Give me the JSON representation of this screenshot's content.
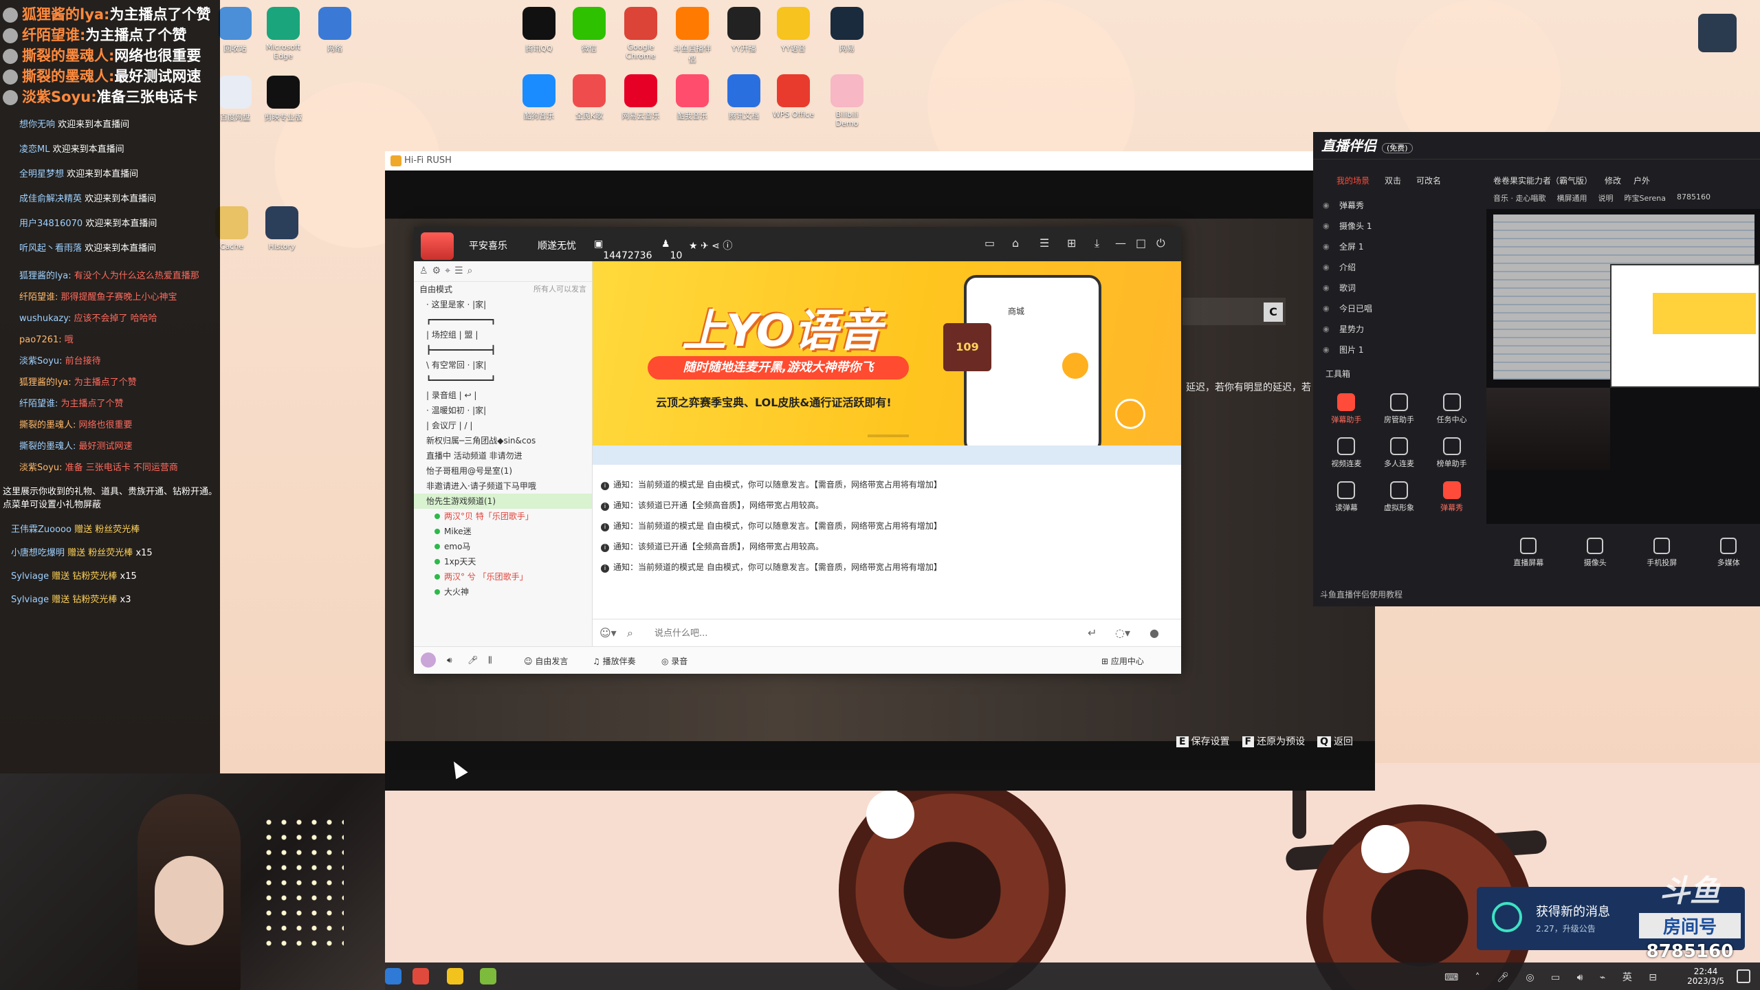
{
  "chat": {
    "big_lines": [
      {
        "user": "狐狸酱的lya:",
        "text": "为主播点了个赞"
      },
      {
        "user": "纤陌望谁:",
        "text": "为主播点了个赞"
      },
      {
        "user": "撕裂的墨魂人:",
        "text": "网络也很重要"
      },
      {
        "user": "撕裂的墨魂人:",
        "text": "最好测试网速"
      },
      {
        "user": "淡紫Soyu:",
        "text": "准备三张电话卡"
      }
    ],
    "welcomes": [
      {
        "user": "想你无响",
        "text": "欢迎来到本直播间"
      },
      {
        "user": "凌恋ML",
        "text": "欢迎来到本直播间"
      },
      {
        "user": "全明星梦想",
        "text": "欢迎来到本直播间"
      },
      {
        "user": "成佳俞解决精英",
        "text": "欢迎来到本直播间"
      },
      {
        "user": "用户34816070",
        "text": "欢迎来到本直播间"
      },
      {
        "user": "听风起丶看雨落",
        "text": "欢迎来到本直播间"
      }
    ],
    "messages": [
      {
        "user": "狐狸酱的lya:",
        "text": "有没个人为什么这么热爱直播那"
      },
      {
        "user": "纤陌望谁:",
        "text": "那得提醒鱼子赛晚上小心神宝"
      },
      {
        "user": "wushukazy:",
        "text": "应该不会掉了 哈哈哈"
      },
      {
        "user": "pao7261:",
        "text": "哦"
      },
      {
        "user": "淡紫Soyu:",
        "text": "前台接待"
      },
      {
        "user": "狐狸酱的lya:",
        "text": "为主播点了个赞"
      },
      {
        "user": "纤陌望谁:",
        "text": "为主播点了个赞"
      },
      {
        "user": "撕裂的墨魂人:",
        "text": "网络也很重要"
      },
      {
        "user": "撕裂的墨魂人:",
        "text": "最好测试网速"
      },
      {
        "user": "淡紫Soyu:",
        "text": "准备 三张电话卡 不同运营商"
      }
    ],
    "info": "这里展示你收到的礼物、道具、贵族开通、钻粉开通。点菜单可设置小礼物屏蔽",
    "gifts": [
      {
        "user": "王伟霖Zuoooo",
        "text": "赠送 粉丝荧光棒"
      },
      {
        "user": "小唐想吃爆明",
        "text": "赠送 粉丝荧光棒",
        "count": "x15"
      },
      {
        "user": "Sylviage",
        "text": "赠送 钻粉荧光棒",
        "count": "x15"
      },
      {
        "user": "Sylviage",
        "text": "赠送 钻粉荧光棒",
        "count": "x3"
      }
    ]
  },
  "desktop": {
    "icons": [
      {
        "label": "回收站",
        "icon": "recycle-bin",
        "color": "#4a8fd8"
      },
      {
        "label": "Microsoft Edge",
        "icon": "edge",
        "color": "#1aa57c"
      },
      {
        "label": "网络",
        "icon": "network",
        "color": "#3a7ad6"
      },
      {
        "label": "腾讯QQ",
        "icon": "qq",
        "color": "#111111"
      },
      {
        "label": "微信",
        "icon": "wechat",
        "color": "#2dc100"
      },
      {
        "label": "Google Chrome",
        "icon": "chrome",
        "color": "#db4437"
      },
      {
        "label": "斗鱼直播伴侣",
        "icon": "douyu",
        "color": "#ff7a00"
      },
      {
        "label": "YY开播",
        "icon": "yy-open",
        "color": "#222222"
      },
      {
        "label": "YY语音",
        "icon": "yy",
        "color": "#f7c31e"
      },
      {
        "label": "网易",
        "icon": "app",
        "color": "#1a2b3d"
      },
      {
        "label": "百度网盘",
        "icon": "baidu",
        "color": "#e8ecf4"
      },
      {
        "label": "剪映专业版",
        "icon": "capcut",
        "color": "#111111"
      },
      {
        "label": "酷狗音乐",
        "icon": "kugou",
        "color": "#1a8cff"
      },
      {
        "label": "全民K歌",
        "icon": "ksong",
        "color": "#ef4d4d"
      },
      {
        "label": "网易云音乐",
        "icon": "netease",
        "color": "#e60026"
      },
      {
        "label": "酷我音乐",
        "icon": "kuwo",
        "color": "#ff4d6d"
      },
      {
        "label": "腾讯文档",
        "icon": "docs",
        "color": "#2a6fe0"
      },
      {
        "label": "WPS Office",
        "icon": "wps",
        "color": "#e83b2e"
      },
      {
        "label": "Bilibili Demo",
        "icon": "bili",
        "color": "#f7b7c4"
      },
      {
        "label": "Cache",
        "icon": "folder",
        "color": "#e8c265"
      },
      {
        "label": "History",
        "icon": "file",
        "color": "#2b3e5a"
      }
    ]
  },
  "game": {
    "title": "Hi-Fi RUSH",
    "side_key": "C",
    "side_text": "延迟，若你有明显的延迟，若",
    "options": [
      {
        "key": "E",
        "label": "保存设置"
      },
      {
        "key": "F",
        "label": "还原为预设"
      },
      {
        "key": "Q",
        "label": "返回"
      }
    ]
  },
  "yy": {
    "channel_name": "平安喜乐",
    "status": "顺遂无忧",
    "channel_id": "14472736",
    "online": "10",
    "mode": "自由模式",
    "mode_hint": "所有人可以发言",
    "tree": [
      "· 这里是家 · |家|",
      "┏━━━━━━━━━━━━┓",
      "| 场控组 | 盟 |",
      "┣━━━━━━━━━━━━┫",
      "\\ 有空常回 · |家|",
      "┗━━━━━━━━━━━━┛",
      "| 录音组 | ↩ |",
      "· 温暖如初 · |家|",
      "| 会议厅 | / |",
      "新权归属─三角团战◆sin&cos",
      "直播中 活动频道 非请勿进",
      "怡子哥租用@号是室(1)",
      "非邀请进入·请子频道下马甲哦",
      "怡先生游戏频道(1)",
      "两汉°贝 特「乐团歌手」",
      "Mike迷",
      "emo马",
      "1xp天天",
      "两汉° 兮 「乐团歌手」",
      "大火神"
    ],
    "banner": {
      "title": "上YO语音",
      "pill": "随时随地连麦开黑,游戏大神带你飞",
      "sub": "云顶之弈赛季宝典、LOL皮肤&通行证活跃即有!",
      "shop": "商城",
      "card": "109"
    },
    "notices": [
      "通知：当前频道的模式是 自由模式，你可以随意发言。【需音质，网络带宽占用将有增加】",
      "通知：该频道已开通【全频高音质】，网络带宽占用较高。",
      "通知：当前频道的模式是 自由模式，你可以随意发言。【需音质，网络带宽占用将有增加】",
      "通知：该频道已开通【全频高音质】，网络带宽占用较高。",
      "通知：当前频道的模式是 自由模式，你可以随意发言。【需音质，网络带宽占用将有增加】"
    ],
    "input_placeholder": "说点什么吧...",
    "bottom": {
      "free": "自由发言",
      "player": "播放伴奏",
      "record": "录音",
      "app_center": "应用中心"
    }
  },
  "companion": {
    "title": "直播伴侣",
    "tag": "(免费)",
    "tabs": [
      "我的场景",
      "双击",
      "可改名"
    ],
    "scenes": [
      "弹幕秀",
      "摄像头 1",
      "全屏 1",
      "介绍",
      "歌词",
      "今日已唱",
      "星势力",
      "图片 1"
    ],
    "room_title": "卷卷果实能力者（霸气版）",
    "edit": "修改",
    "category": "户外",
    "sub": [
      "音乐 · 走心唱歌",
      "横屏通用",
      "说明",
      "昨宝Serena",
      "8785160"
    ],
    "tools_title": "工具箱",
    "tools": [
      {
        "label": "弹幕助手",
        "red": true
      },
      {
        "label": "房管助手",
        "red": false
      },
      {
        "label": "任务中心",
        "red": false
      },
      {
        "label": "视频连麦",
        "red": false
      },
      {
        "label": "多人连麦",
        "red": false
      },
      {
        "label": "榜单助手",
        "red": false
      },
      {
        "label": "读弹幕",
        "red": false
      },
      {
        "label": "虚拟形象",
        "red": false
      },
      {
        "label": "弹幕秀",
        "red": true
      }
    ],
    "bottom_tools": [
      "直播屏幕",
      "摄像头",
      "手机投屏",
      "多媒体"
    ],
    "tutorial": "斗鱼直播伴侣使用教程"
  },
  "notification": {
    "title": "获得新的消息",
    "sub": "2.27，升级公告"
  },
  "room": {
    "brand": "斗鱼",
    "label": "房间号",
    "number": "8785160"
  },
  "taskbar": {
    "time": "22:44",
    "date": "2023/3/5",
    "lang": "英"
  },
  "colors": {
    "accent_red": "#ff4b3a",
    "chat_bg": "#000000",
    "yy_banner": "#ffc51f"
  }
}
